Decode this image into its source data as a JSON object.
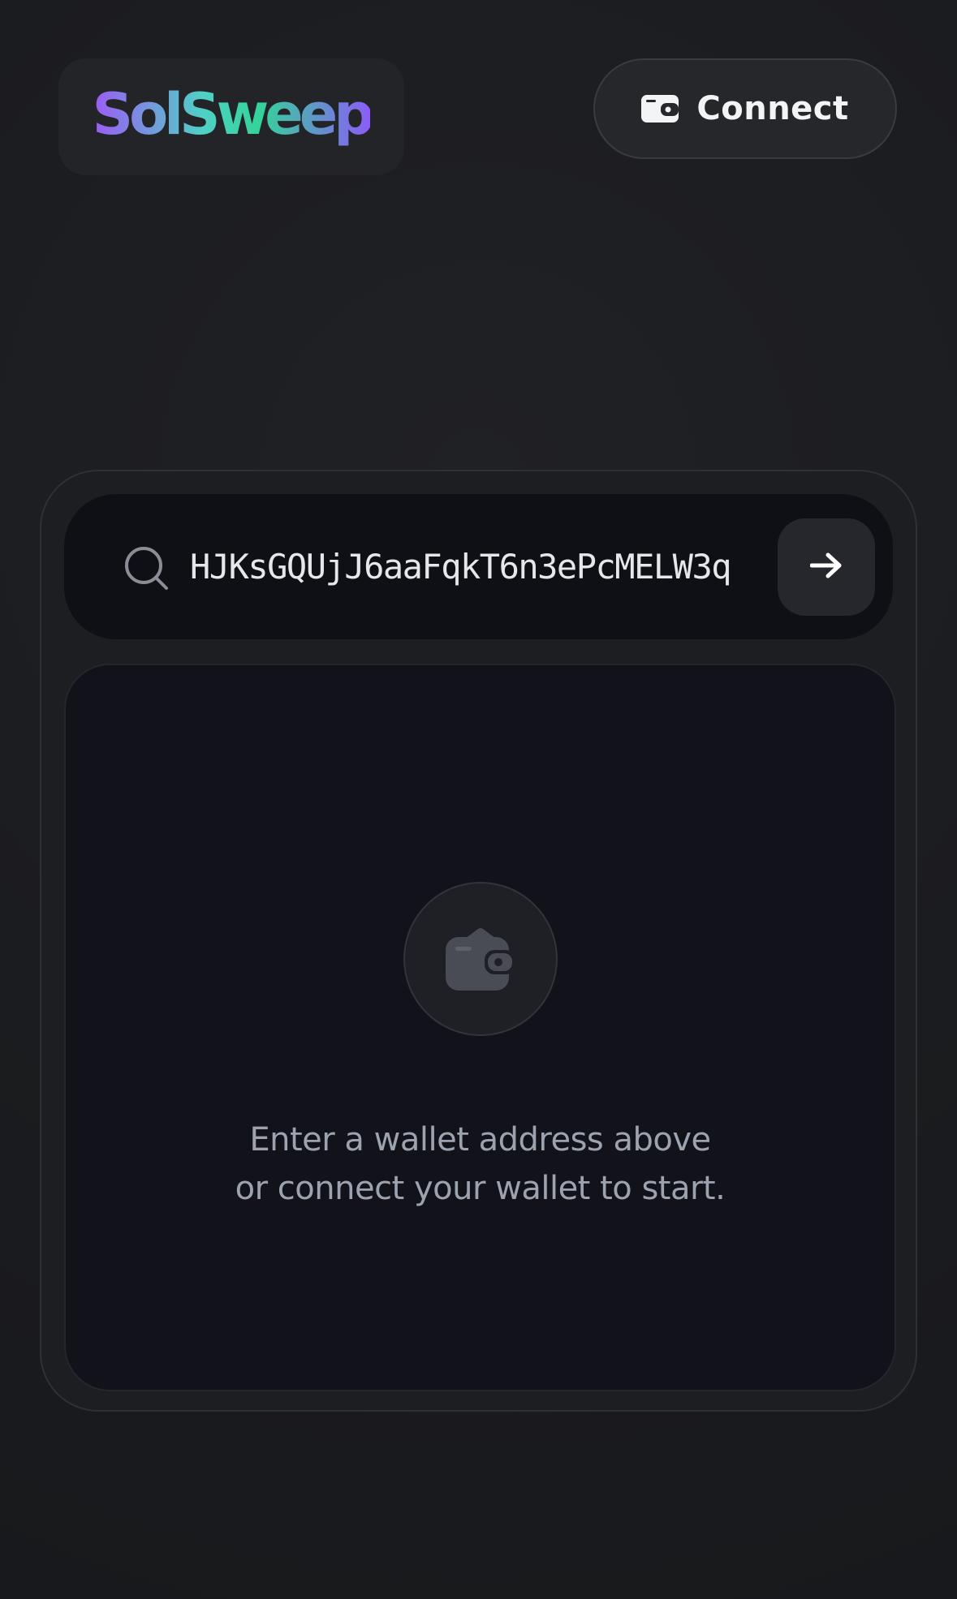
{
  "header": {
    "logo_text": "SolSweep",
    "connect_label": "Connect",
    "connect_icon": "wallet-icon"
  },
  "search": {
    "value": "HJKsGQUjJ6aaFqkT6n3ePcMELW3q",
    "icon": "search-icon",
    "submit_icon": "arrow-right-icon"
  },
  "empty_state": {
    "icon": "wallet-icon",
    "line1": "Enter a wallet address above",
    "line2": "or connect your wallet to start."
  },
  "colors": {
    "background": "#1b1c1f",
    "card": "#1d1e22",
    "search_bar": "#0f1016",
    "panel": "#11121a",
    "logo_gradient_start": "#9b5cf6",
    "logo_gradient_mid": "#34d399",
    "logo_gradient_end": "#8b5cf6",
    "muted_text": "#9ca3af"
  }
}
